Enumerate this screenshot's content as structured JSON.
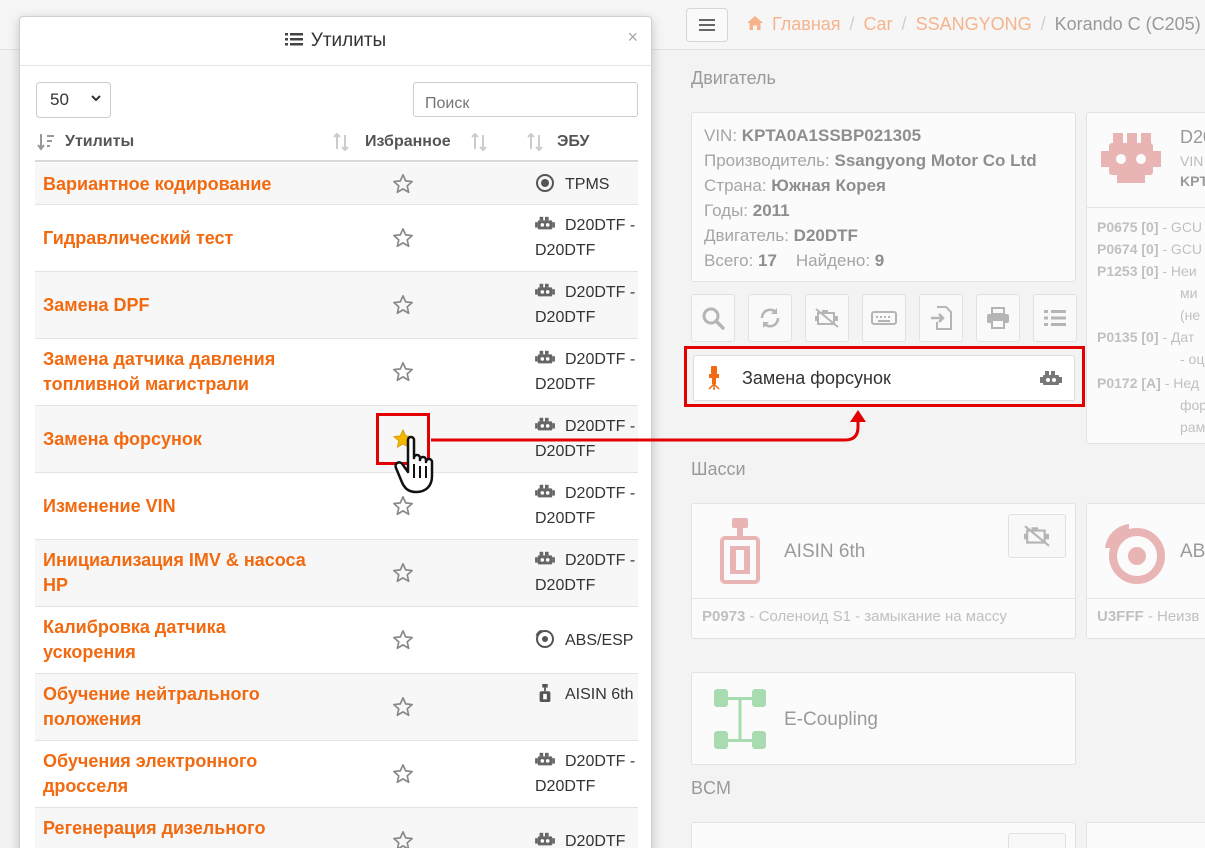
{
  "breadcrumb": {
    "home": "Главная",
    "car": "Car",
    "brand": "SSANGYONG",
    "model": "Korando C (C205)"
  },
  "engine_section": {
    "title": "Двигатель",
    "vin_label": "VIN:",
    "vin": "KPTA0A1SSBP021305",
    "manufacturer_label": "Производитель:",
    "manufacturer": "Ssangyong Motor Co Ltd",
    "country_label": "Страна:",
    "country": "Южная Корея",
    "years_label": "Годы:",
    "years": "2011",
    "engine_label": "Двигатель:",
    "engine": "D20DTF",
    "total_label": "Всего:",
    "total": "17",
    "found_label": "Найдено:",
    "found": "9",
    "card_title": "D20",
    "card_vin": "VIN",
    "card_vin2": "KPT",
    "dtc": [
      {
        "code": "P0675 [0]",
        "text": " - GCU"
      },
      {
        "code": "P0674 [0]",
        "text": " - GCU"
      },
      {
        "code": "P1253 [0]",
        "text": " - Неи"
      },
      {
        "code": "",
        "text": "ми"
      },
      {
        "code": "",
        "text": "(не"
      },
      {
        "code": "P0135 [0]",
        "text": " - Дат"
      },
      {
        "code": "",
        "text": "- оц"
      },
      {
        "code": "P0172 [A]",
        "text": " - Нед"
      },
      {
        "code": "",
        "text": "фор"
      },
      {
        "code": "",
        "text": "рам"
      }
    ]
  },
  "popup_item": {
    "label": "Замена форсунок"
  },
  "chassis_section": {
    "title": "Шасси",
    "aisin": {
      "title": "AISIN 6th",
      "dtc_code": "P0973",
      "dtc_text": " - Соленоид S1 - замыкание на массу"
    },
    "abs": {
      "title": "ABS",
      "dtc_code": "U3FFF",
      "dtc_text": " - Неизв"
    },
    "ecoupling": {
      "title": "E-Coupling"
    }
  },
  "bcm_section": {
    "title": "BCM"
  },
  "modal": {
    "title": "Утилиты",
    "page_length": "50",
    "search_placeholder": "Поиск",
    "col_utility": "Утилиты",
    "col_favorite": "Избранное",
    "col_ecu": "ЭБУ",
    "rows": [
      {
        "name": "Вариантное кодирование",
        "ecu": "TPMS",
        "ecu_icon": "tpms-icon",
        "favorite": false
      },
      {
        "name": "Гидравлический тест",
        "ecu": "D20DTF - D20DTF",
        "ecu_icon": "engine-icon",
        "favorite": false
      },
      {
        "name": "Замена DPF",
        "ecu": "D20DTF - D20DTF",
        "ecu_icon": "engine-icon",
        "favorite": false
      },
      {
        "name": "Замена датчика давления топливной магистрали",
        "ecu": "D20DTF - D20DTF",
        "ecu_icon": "engine-icon",
        "favorite": false
      },
      {
        "name": "Замена форсунок",
        "ecu": "D20DTF - D20DTF",
        "ecu_icon": "engine-icon",
        "favorite": true
      },
      {
        "name": "Изменение VIN",
        "ecu": "D20DTF - D20DTF",
        "ecu_icon": "engine-icon",
        "favorite": false
      },
      {
        "name": "Инициализация IMV & насоса HP",
        "ecu": "D20DTF - D20DTF",
        "ecu_icon": "engine-icon",
        "favorite": false
      },
      {
        "name": "Калибровка датчика ускорения",
        "ecu": "ABS/ESP",
        "ecu_icon": "abs-icon",
        "favorite": false
      },
      {
        "name": "Обучение нейтрального положения",
        "ecu": "AISIN 6th",
        "ecu_icon": "gearbox-icon",
        "favorite": false
      },
      {
        "name": "Обучения электронного дросселя",
        "ecu": "D20DTF - D20DTF",
        "ecu_icon": "engine-icon",
        "favorite": false
      },
      {
        "name": "Регенерация дизельного",
        "ecu": "D20DTF",
        "ecu_icon": "engine-icon",
        "favorite": false
      }
    ]
  },
  "colors": {
    "accent": "#f26a10",
    "highlight": "#e20000",
    "star_active": "#f5b800"
  }
}
